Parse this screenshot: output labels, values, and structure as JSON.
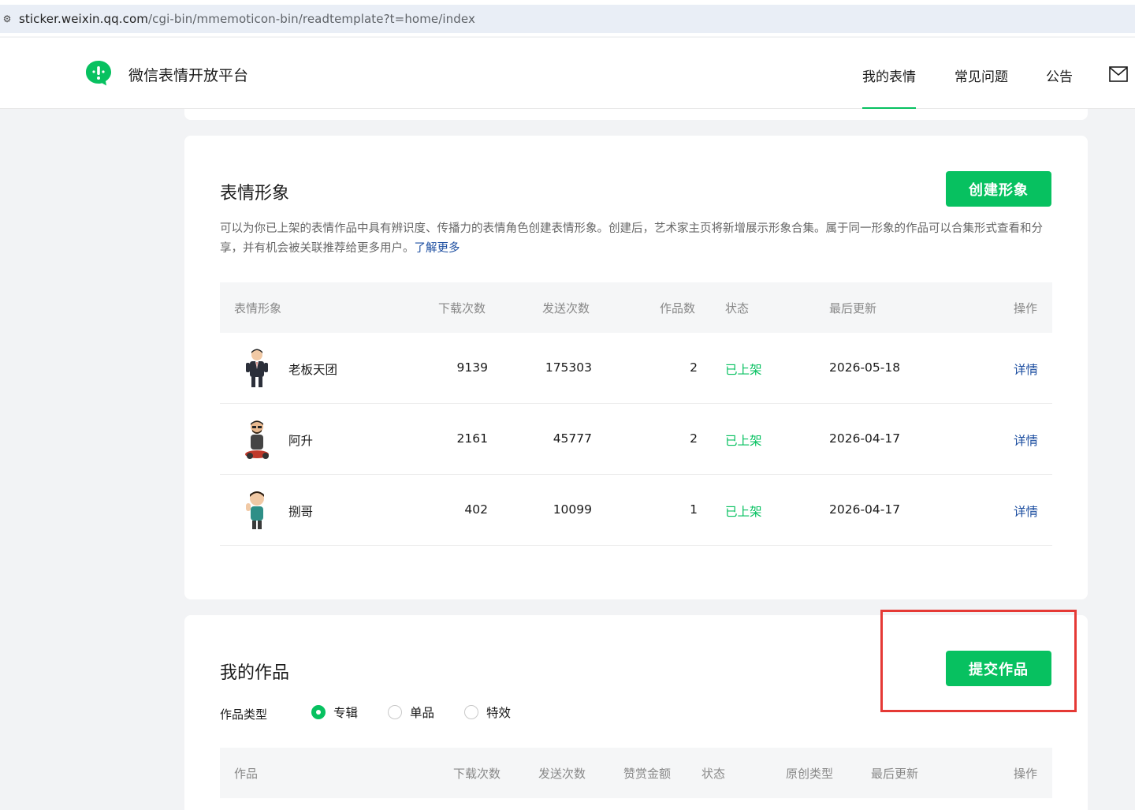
{
  "browser": {
    "url_host": "sticker.weixin.qq.com",
    "url_path": "/cgi-bin/mmemoticon-bin/readtemplate?t=home/index"
  },
  "header": {
    "brand": "微信表情开放平台",
    "nav": [
      {
        "label": "我的表情",
        "active": true
      },
      {
        "label": "常见问题",
        "active": false
      },
      {
        "label": "公告",
        "active": false
      }
    ],
    "mail_icon": "mail-icon"
  },
  "characters": {
    "title": "表情形象",
    "create_button": "创建形象",
    "description": "可以为你已上架的表情作品中具有辨识度、传播力的表情角色创建表情形象。创建后，艺术家主页将新增展示形象合集。属于同一形象的作品可以合集形式查看和分享，并有机会被关联推荐给更多用户。",
    "learn_more": "了解更多",
    "columns": [
      "表情形象",
      "下载次数",
      "发送次数",
      "作品数",
      "状态",
      "最后更新",
      "操作"
    ],
    "rows": [
      {
        "name": "老板天团",
        "downloads": "9139",
        "sends": "175303",
        "works": "2",
        "status": "已上架",
        "updated": "2026-05-18",
        "action": "详情"
      },
      {
        "name": "阿升",
        "downloads": "2161",
        "sends": "45777",
        "works": "2",
        "status": "已上架",
        "updated": "2026-04-17",
        "action": "详情"
      },
      {
        "name": "捌哥",
        "downloads": "402",
        "sends": "10099",
        "works": "1",
        "status": "已上架",
        "updated": "2026-04-17",
        "action": "详情"
      }
    ],
    "colors": {
      "accent": "#07c160",
      "link": "#1e4fa1"
    }
  },
  "works": {
    "title": "我的作品",
    "submit_button": "提交作品",
    "type_label": "作品类型",
    "types": [
      {
        "label": "专辑",
        "selected": true
      },
      {
        "label": "单品",
        "selected": false
      },
      {
        "label": "特效",
        "selected": false
      }
    ],
    "columns": [
      "作品",
      "下载次数",
      "发送次数",
      "赞赏金额",
      "状态",
      "原创类型",
      "最后更新",
      "操作"
    ]
  }
}
